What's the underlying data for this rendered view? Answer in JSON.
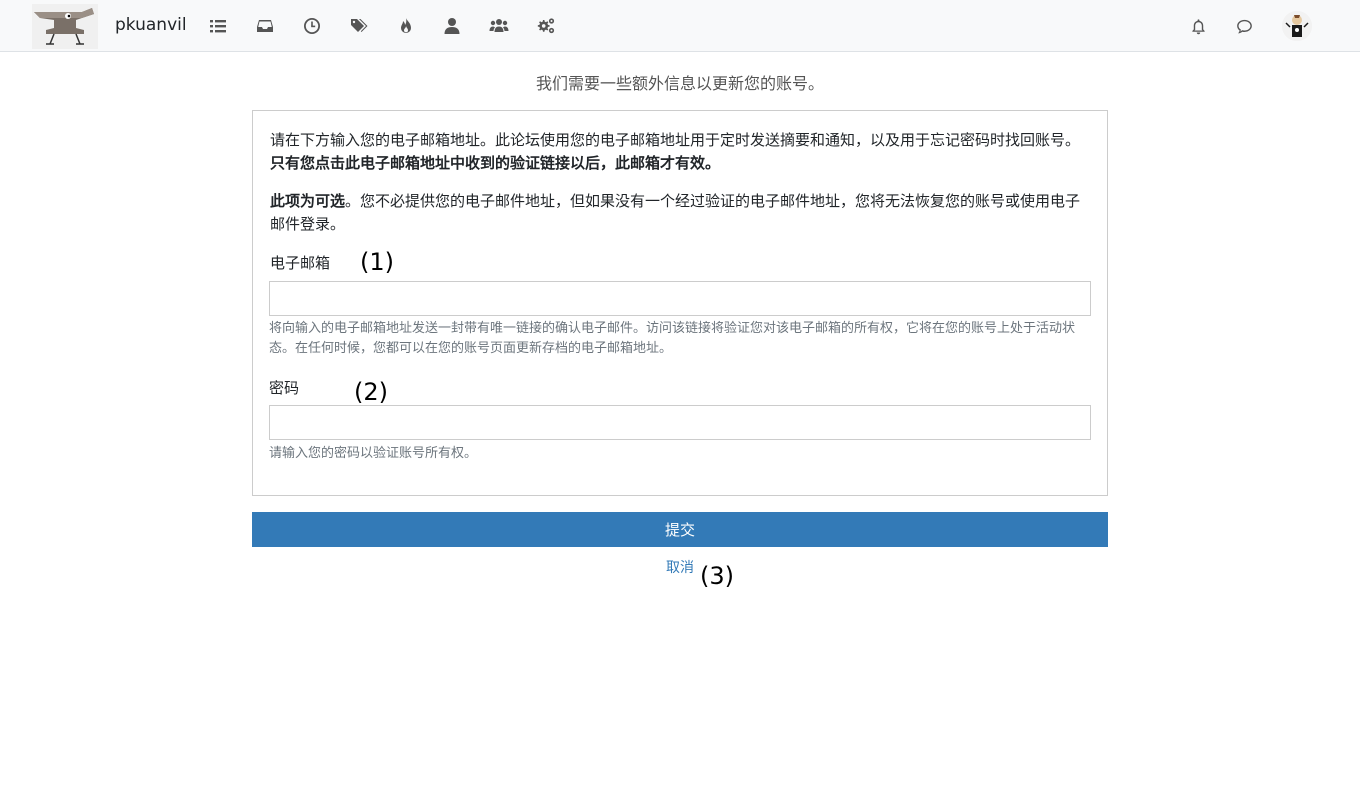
{
  "header": {
    "brand": "pkuanvil",
    "nav": [
      {
        "name": "recent-topics-icon"
      },
      {
        "name": "inbox-icon"
      },
      {
        "name": "clock-icon"
      },
      {
        "name": "tags-icon"
      },
      {
        "name": "fire-icon"
      },
      {
        "name": "user-icon"
      },
      {
        "name": "users-icon"
      },
      {
        "name": "gears-icon"
      }
    ],
    "right": [
      {
        "name": "bell-icon"
      },
      {
        "name": "chat-icon"
      }
    ]
  },
  "intro": "我们需要一些额外信息以更新您的账号。",
  "panel": {
    "p1_line": "请在下方输入您的电子邮箱地址。此论坛使用您的电子邮箱地址用于定时发送摘要和通知，以及用于忘记密码时找回账号。",
    "p1_bold": "只有您点击此电子邮箱地址中收到的验证链接以后，此邮箱才有效。",
    "p2_bold": "此项为可选",
    "p2_rest": "。您不必提供您的电子邮件地址，但如果没有一个经过验证的电子邮件地址，您将无法恢复您的账号或使用电子邮件登录。",
    "email_label": "电子邮箱",
    "email_value": "",
    "email_help": "将向输入的电子邮箱地址发送一封带有唯一链接的确认电子邮件。访问该链接将验证您对该电子邮箱的所有权，它将在您的账号上处于活动状态。在任何时候，您都可以在您的账号页面更新存档的电子邮箱地址。",
    "password_label": "密码",
    "password_value": "",
    "password_help": "请输入您的密码以验证账号所有权。"
  },
  "actions": {
    "submit": "提交",
    "cancel": "取消"
  },
  "markers": [
    "(1)",
    "(2)",
    "(3)"
  ],
  "colors": {
    "accent": "#337ab7",
    "header_bg": "#f8f9fa"
  }
}
